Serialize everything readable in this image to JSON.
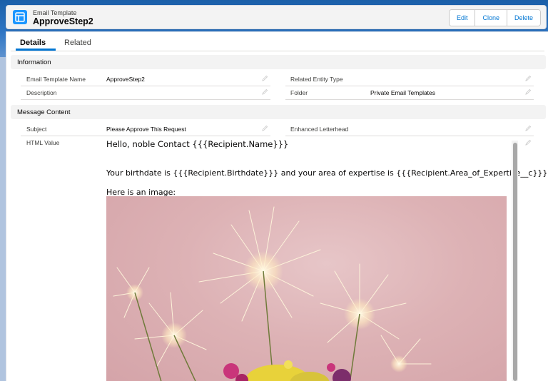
{
  "header": {
    "eyebrow": "Email Template",
    "title": "ApproveStep2",
    "buttons": {
      "edit": "Edit",
      "clone": "Clone",
      "delete": "Delete"
    }
  },
  "tabs": {
    "details": "Details",
    "related": "Related"
  },
  "sections": {
    "information": {
      "title": "Information",
      "email_template_name_label": "Email Template Name",
      "email_template_name_value": "ApproveStep2",
      "description_label": "Description",
      "description_value": "",
      "related_entity_type_label": "Related Entity Type",
      "related_entity_type_value": "",
      "folder_label": "Folder",
      "folder_value": "Private Email Templates"
    },
    "message_content": {
      "title": "Message Content",
      "subject_label": "Subject",
      "subject_value": "Please Approve This Request",
      "enhanced_letterhead_label": "Enhanced Letterhead",
      "enhanced_letterhead_value": "",
      "html_value_label": "HTML Value",
      "html_lines": [
        "Hello, noble Contact {{{Recipient.Name}}}",
        "Your birthdate is {{{Recipient.Birthdate}}} and your area of expertise is {{{Recipient.Area_of_Expertise__c}}}",
        "Here is an image:"
      ]
    }
  },
  "colors": {
    "brand": "#0176d3",
    "header_bg": "#1b5fa8",
    "image_pink": "#ddb2b5"
  },
  "icons": {
    "object": "email-template-icon",
    "edit": "pencil-icon"
  }
}
